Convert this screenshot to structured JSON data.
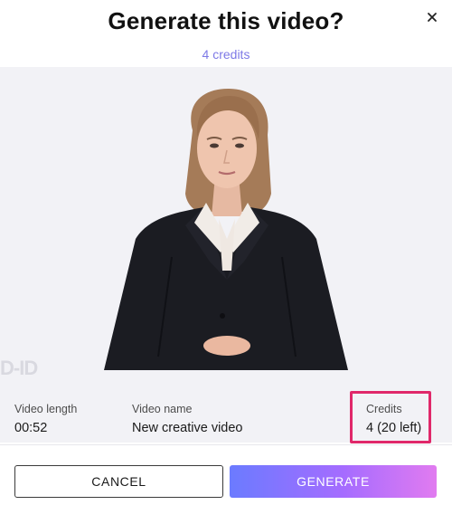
{
  "dialog": {
    "title": "Generate this video?",
    "subtitle": "4 credits",
    "close_icon": "close-icon"
  },
  "preview": {
    "watermark_text": "D-ID",
    "avatar": "presenter-woman-dark-blazer-white-collar"
  },
  "info": {
    "length_label": "Video length",
    "length_value": "00:52",
    "name_label": "Video name",
    "name_value": "New creative video",
    "credits_label": "Credits",
    "credits_value": "4 (20 left)"
  },
  "footer": {
    "cancel_label": "CANCEL",
    "generate_label": "GENERATE"
  },
  "colors": {
    "accent": "#7d79e6",
    "highlight_border": "#e0286a",
    "generate_gradient_start": "#6b7bff",
    "generate_gradient_end": "#e17bf0",
    "preview_bg": "#f2f2f6"
  }
}
